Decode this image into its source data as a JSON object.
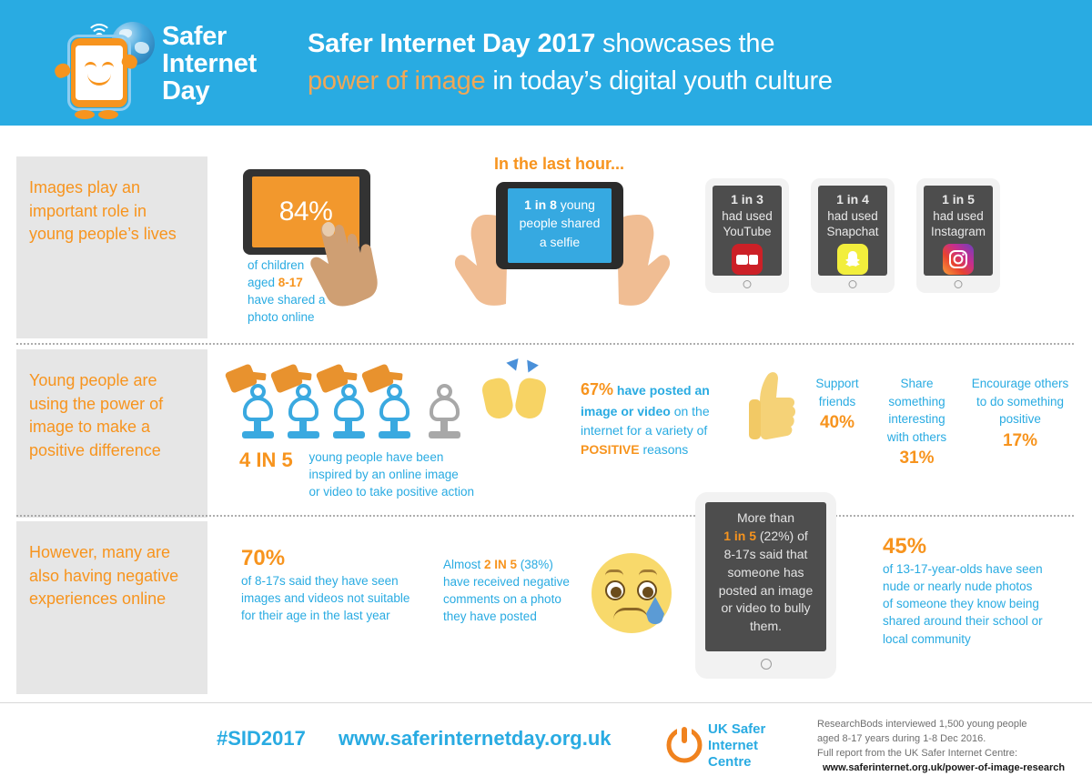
{
  "header": {
    "logo_line1": "Safer",
    "logo_line2": "Internet",
    "logo_line3": "Day",
    "title_bold": "Safer Internet Day 2017",
    "title_rest": " showcases the",
    "subtitle_orange": "power of image",
    "subtitle_rest": " in today’s digital youth culture"
  },
  "row1": {
    "panel": "Images play an important role in young people’s lives",
    "tablet_percent": "84%",
    "tablet_caption_1": "of children",
    "tablet_caption_2a": "aged ",
    "tablet_caption_2b": "8-17",
    "tablet_caption_3": "have shared a",
    "tablet_caption_4": "photo online",
    "last_hour_label": "In the last hour...",
    "selfie_bold": "1 in 8",
    "selfie_rest": " young",
    "selfie_line2": "people shared",
    "selfie_line3": "a selfie",
    "apps": [
      {
        "stat": "1 in 3",
        "line2": "had used",
        "line3": "YouTube",
        "icon": "youtube-icon",
        "color": "#cc2027"
      },
      {
        "stat": "1 in 4",
        "line2": "had used",
        "line3": "Snapchat",
        "icon": "snapchat-icon",
        "color": "#f2ee3c"
      },
      {
        "stat": "1 in 5",
        "line2": "had used",
        "line3": "Instagram",
        "icon": "instagram-icon",
        "color": "#c72e8e"
      }
    ]
  },
  "row2": {
    "panel": "Young people are using the power of image to make a positive difference",
    "fourinfive_big": "4 IN 5",
    "fourinfive_l1": "young people have been",
    "fourinfive_l2": "inspired by an online image",
    "fourinfive_l3": "or video to take positive action",
    "posted_67": "67%",
    "posted_a": " have posted an",
    "posted_b": "image or video",
    "posted_c": " on the",
    "posted_d": "internet for a variety of",
    "posted_e": "POSITIVE",
    "posted_f": " reasons",
    "reasons": [
      {
        "lines": [
          "Support",
          "friends"
        ],
        "value": "40%"
      },
      {
        "lines": [
          "Share",
          "something",
          "interesting",
          "with others"
        ],
        "value": "31%"
      },
      {
        "lines": [
          "Encourage others",
          "to do something",
          "positive"
        ],
        "value": "17%"
      }
    ]
  },
  "row3": {
    "panel": "However, many are also having negative experiences online",
    "stat70_value": "70%",
    "stat70_l1": "of 8-17s said they have seen",
    "stat70_l2": "images and videos not suitable",
    "stat70_l3": "for their age in the last year",
    "neg_a": "Almost ",
    "neg_b": "2 IN 5",
    "neg_c": " (38%)",
    "neg_l2": "have received negative",
    "neg_l3": "comments on a photo",
    "neg_l4": "they have posted",
    "bully_l1": "More than",
    "bully_orange": "1 in 5",
    "bully_l2_rest": " (22%) of",
    "bully_l3": "8-17s said that",
    "bully_l4": "someone has",
    "bully_l5": "posted an image",
    "bully_l6": "or video to bully",
    "bully_l7": "them.",
    "stat45_value": "45%",
    "stat45_l1": "of 13-17-year-olds have seen",
    "stat45_l2": "nude or nearly nude photos",
    "stat45_l3": "of someone they know being",
    "stat45_l4": "shared around their school or",
    "stat45_l5": "local community"
  },
  "footer": {
    "hashtag": "#SID2017",
    "website": "www.saferinternetday.org.uk",
    "uksic_l1": "UK Safer",
    "uksic_l2": "Internet",
    "uksic_l3": "Centre",
    "source_l1": "ResearchBods interviewed 1,500 young people",
    "source_l2": "aged 8-17 years during 1-8 Dec 2016.",
    "source_l3": "Full report from the UK Safer Internet Centre:",
    "source_l4": "www.saferinternet.org.uk/power-of-image-research"
  },
  "colors": {
    "brand_blue": "#29abe2",
    "brand_orange": "#f7941e",
    "panel_grey": "#e6e6e6",
    "dark_tablet": "#4d4d4d"
  }
}
